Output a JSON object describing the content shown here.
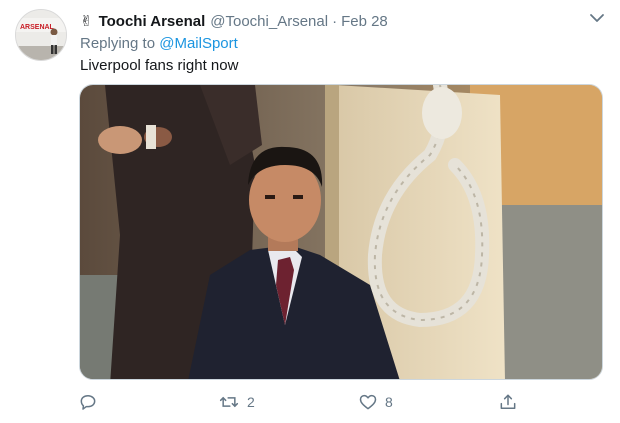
{
  "author": {
    "emoji": "✌",
    "name": "Toochi Arsenal",
    "handle": "@Toochi_Arsenal",
    "separator": "·",
    "date": "Feb 28",
    "avatar_text": "ARSENAL"
  },
  "reply": {
    "prefix": "Replying to",
    "mention": "@MailSport"
  },
  "body": {
    "text": "Liverpool fans right now"
  },
  "media": {
    "description_icon": "photo-meme"
  },
  "actions": {
    "reply_count": "",
    "retweet_count": "2",
    "like_count": "8"
  },
  "colors": {
    "link": "#1b95e0",
    "muted": "#657786",
    "text": "#14171a"
  }
}
